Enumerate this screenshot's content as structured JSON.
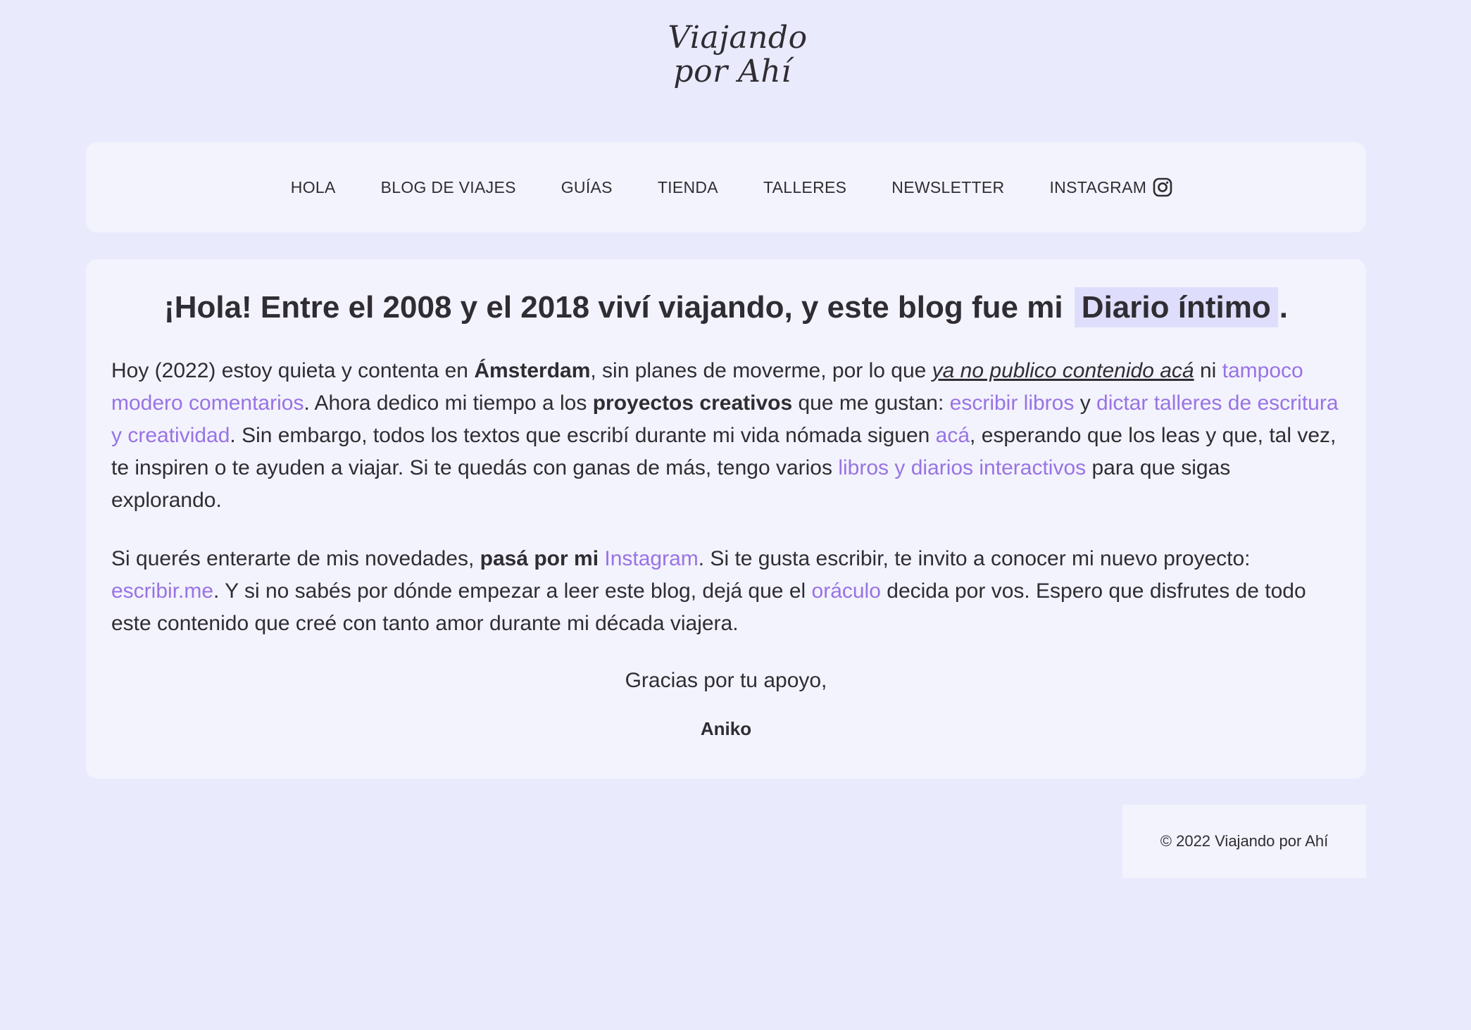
{
  "logo": {
    "line1": "Viajando",
    "line2": "por Ahí"
  },
  "nav": {
    "items": [
      {
        "label": "HOLA"
      },
      {
        "label": "BLOG DE VIAJES"
      },
      {
        "label": "GUÍAS"
      },
      {
        "label": "TIENDA"
      },
      {
        "label": "TALLERES"
      },
      {
        "label": "NEWSLETTER"
      },
      {
        "label": "INSTAGRAM",
        "icon": "instagram-icon"
      }
    ]
  },
  "main": {
    "heading": {
      "text": "¡Hola! Entre el 2008 y el 2018 viví viajando, y este blog fue mi",
      "highlight": "Diario íntimo",
      "end": "."
    },
    "p1": {
      "t1": "Hoy (2022) estoy quieta y contenta en ",
      "b1": "Ámsterdam",
      "t2": ", sin planes de moverme, por lo que ",
      "u1": "ya no publico contenido acá",
      "t3": " ni ",
      "l1": "tampoco modero comentarios",
      "t4": ". Ahora dedico mi tiempo a los ",
      "b2": "proyectos creativos",
      "t5": " que me gustan: ",
      "l2": "escribir libros",
      "t6": " y ",
      "l3": "dictar talleres de escritura y creatividad",
      "t7": ". Sin embargo, todos los textos que escribí durante mi vida nómada siguen ",
      "l4": "acá",
      "t8": ", esperando que los leas y que, tal vez, te inspiren o te ayuden a viajar. Si te quedás con ganas de más, tengo varios ",
      "l5": "libros y diarios interactivos",
      "t9": " para que sigas explorando."
    },
    "p2": {
      "t1": "Si querés enterarte de mis novedades, ",
      "b1": "pasá por mi",
      "t2": " ",
      "l1": "Instagram",
      "t3": ". Si te gusta escribir, te invito a conocer mi nuevo proyecto: ",
      "l2": "escribir.me",
      "t4": ". Y si no sabés por dónde empezar a leer este blog, dejá que el ",
      "l3": "oráculo",
      "t5": " decida por vos. Espero que disfrutes de todo este contenido que creé con tanto amor durante mi década viajera."
    },
    "thanks": "Gracias por tu apoyo,",
    "signature": "Aniko"
  },
  "footer": {
    "copyright": "© 2022 Viajando por Ahí"
  },
  "colors": {
    "background": "#eaeafd",
    "card": "#f3f3fd",
    "link": "#9873e4",
    "highlight": "#dedefc",
    "text": "#2f2d33"
  }
}
